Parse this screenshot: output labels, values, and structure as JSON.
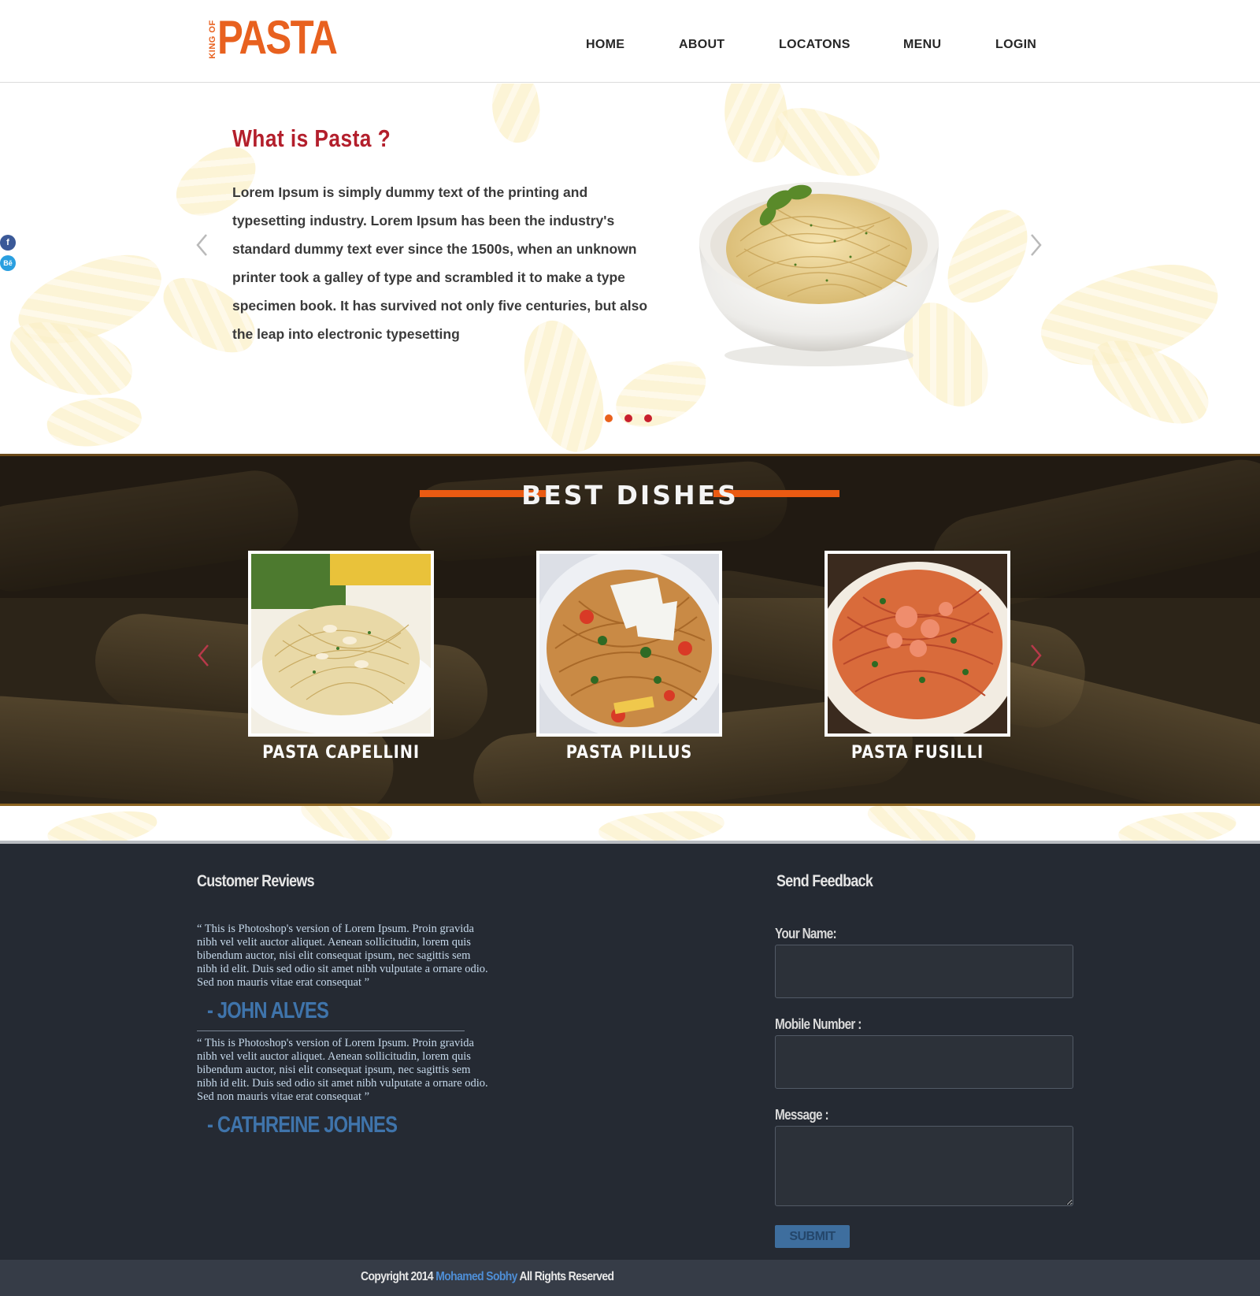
{
  "header": {
    "logo_small": "KING OF",
    "logo_word": "PASTA",
    "nav": [
      {
        "label": "HOME"
      },
      {
        "label": "ABOUT"
      },
      {
        "label": "LOCATONS"
      },
      {
        "label": "MENU"
      },
      {
        "label": "LOGIN"
      }
    ]
  },
  "social": {
    "facebook": "f",
    "behance": "Bē"
  },
  "hero": {
    "title": "What is Pasta ?",
    "text": "Lorem Ipsum is simply dummy text of the printing and typesetting industry. Lorem Ipsum has been the industry's standard dummy text ever since the 1500s, when an unknown printer took a galley of type and scrambled it to make a type specimen book. It has survived not only five centuries, but also the leap into electronic typesetting",
    "slide_count": 3,
    "active_slide": 1
  },
  "dishes": {
    "title": "BEST DISHES",
    "items": [
      {
        "name": "PASTA CAPELLINI"
      },
      {
        "name": "PASTA PILLUS"
      },
      {
        "name": "PASTA FUSILLI"
      }
    ]
  },
  "reviews": {
    "heading": "Customer Reviews",
    "items": [
      {
        "text": "“ This is Photoshop's version of Lorem Ipsum. Proin gravida nibh vel velit auctor aliquet. Aenean sollicitudin, lorem quis bibendum auctor, nisi elit consequat ipsum, nec sagittis sem nibh id elit. Duis sed odio sit amet nibh vulputate a ornare odio. Sed non mauris vitae erat consequat ”",
        "author": "- JOHN ALVES"
      },
      {
        "text": "“ This is Photoshop's version of Lorem Ipsum. Proin gravida nibh vel velit auctor aliquet. Aenean sollicitudin, lorem quis bibendum auctor, nisi elit consequat ipsum, nec sagittis sem nibh id elit. Duis sed odio sit amet nibh vulputate a ornare odio. Sed non mauris vitae erat consequat ”",
        "author": "- CATHREINE JOHNES"
      }
    ]
  },
  "feedback": {
    "heading": "Send Feedback",
    "name_label": "Your Name:",
    "name_value": "",
    "mobile_label": "Mobile Number :",
    "mobile_value": "",
    "message_label": "Message :",
    "message_value": "",
    "submit_label": "SUBMIT"
  },
  "footer": {
    "copyright_prefix": "Copyright 2014",
    "copyright_author": "Mohamed Sobhy",
    "copyright_suffix": "All Rights Reserved"
  },
  "colors": {
    "accent_orange": "#e8611f",
    "title_red": "#b31f2c",
    "footer_bg": "#252a33",
    "link_blue": "#4e8ed6"
  }
}
